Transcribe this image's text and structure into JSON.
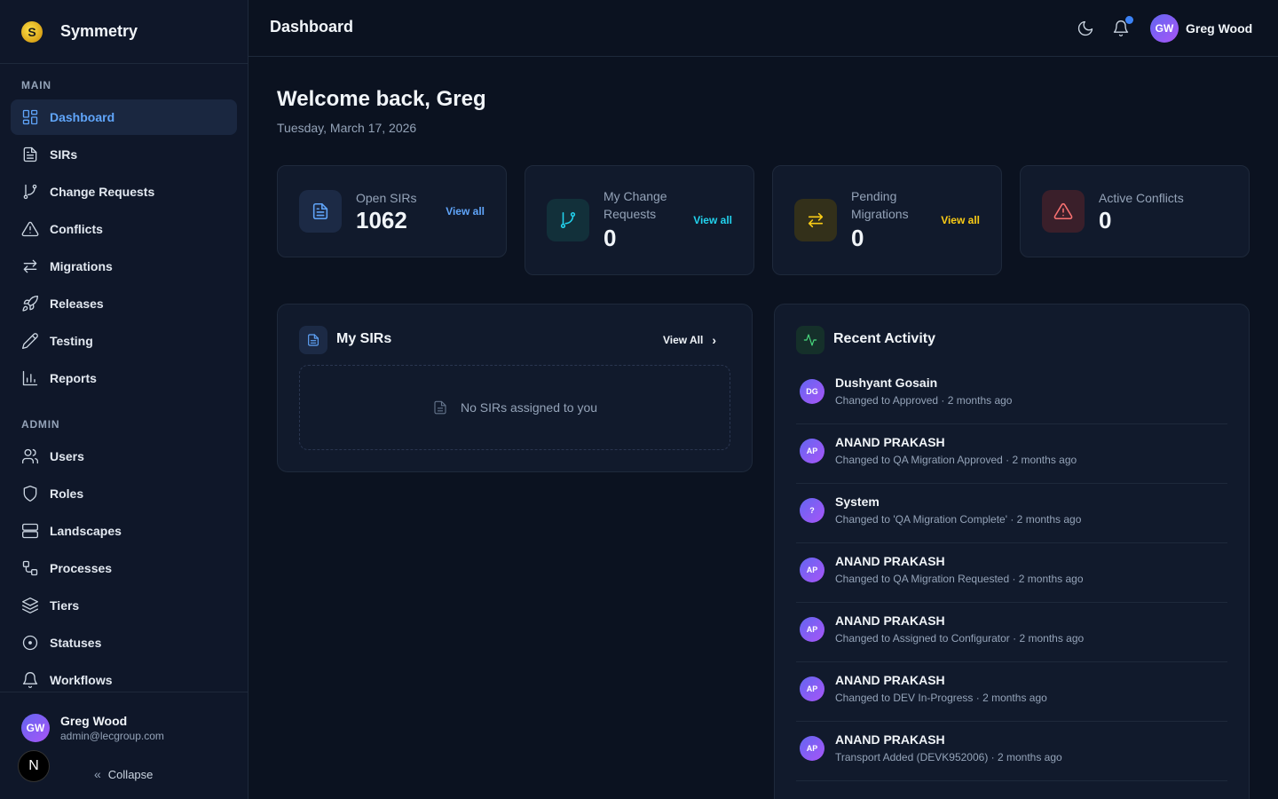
{
  "app": {
    "name": "Symmetry",
    "logo_glyph": "S"
  },
  "sidebar": {
    "main_label": "MAIN",
    "admin_label": "ADMIN",
    "main_items": [
      {
        "label": "Dashboard",
        "icon": "dashboard-icon",
        "active": true
      },
      {
        "label": "SIRs",
        "icon": "file-icon"
      },
      {
        "label": "Change Requests",
        "icon": "git-branch-icon"
      },
      {
        "label": "Conflicts",
        "icon": "warning-icon"
      },
      {
        "label": "Migrations",
        "icon": "arrows-icon"
      },
      {
        "label": "Releases",
        "icon": "rocket-icon"
      },
      {
        "label": "Testing",
        "icon": "pencil-icon"
      },
      {
        "label": "Reports",
        "icon": "bar-chart-icon"
      }
    ],
    "admin_items": [
      {
        "label": "Users",
        "icon": "users-icon"
      },
      {
        "label": "Roles",
        "icon": "shield-icon"
      },
      {
        "label": "Landscapes",
        "icon": "server-icon"
      },
      {
        "label": "Processes",
        "icon": "workflow-icon"
      },
      {
        "label": "Tiers",
        "icon": "layers-icon"
      },
      {
        "label": "Statuses",
        "icon": "circle-dot-icon"
      },
      {
        "label": "Workflows",
        "icon": "bell-icon"
      }
    ],
    "footer": {
      "user_initials": "GW",
      "user_name": "Greg Wood",
      "user_email": "admin@lecgroup.com",
      "next_badge": "N",
      "collapse_label": "Collapse",
      "collapse_glyph": "«"
    }
  },
  "header": {
    "title": "Dashboard",
    "user_initials": "GW",
    "user_name": "Greg Wood"
  },
  "main": {
    "welcome": "Welcome back, Greg",
    "date": "Tuesday, March 17, 2026",
    "stats": [
      {
        "label": "Open SIRs",
        "value": "1062",
        "link": "View all",
        "color": "#60a5fa"
      },
      {
        "label": "My Change Requests",
        "value": "0",
        "link": "View all",
        "color": "#22d3ee"
      },
      {
        "label": "Pending Migrations",
        "value": "0",
        "link": "View all",
        "color": "#facc15"
      },
      {
        "label": "Active Conflicts",
        "value": "0",
        "link": "",
        "color": "#f87171"
      }
    ],
    "my_sirs": {
      "title": "My SIRs",
      "view_all": "View All",
      "chevron": "›",
      "empty_text": "No SIRs assigned to you"
    },
    "recent_activity": {
      "title": "Recent Activity",
      "items": [
        {
          "initials": "DG",
          "name": "Dushyant Gosain",
          "desc": "Changed to Approved · 2 months ago"
        },
        {
          "initials": "AP",
          "name": "ANAND PRAKASH",
          "desc": "Changed to QA Migration Approved · 2 months ago"
        },
        {
          "initials": "?",
          "name": "System",
          "desc": "Changed to 'QA Migration Complete' · 2 months ago"
        },
        {
          "initials": "AP",
          "name": "ANAND PRAKASH",
          "desc": "Changed to QA Migration Requested · 2 months ago"
        },
        {
          "initials": "AP",
          "name": "ANAND PRAKASH",
          "desc": "Changed to Assigned to Configurator · 2 months ago"
        },
        {
          "initials": "AP",
          "name": "ANAND PRAKASH",
          "desc": "Changed to DEV In-Progress · 2 months ago"
        },
        {
          "initials": "AP",
          "name": "ANAND PRAKASH",
          "desc": "Transport Added (DEVK952006) · 2 months ago"
        }
      ]
    }
  }
}
